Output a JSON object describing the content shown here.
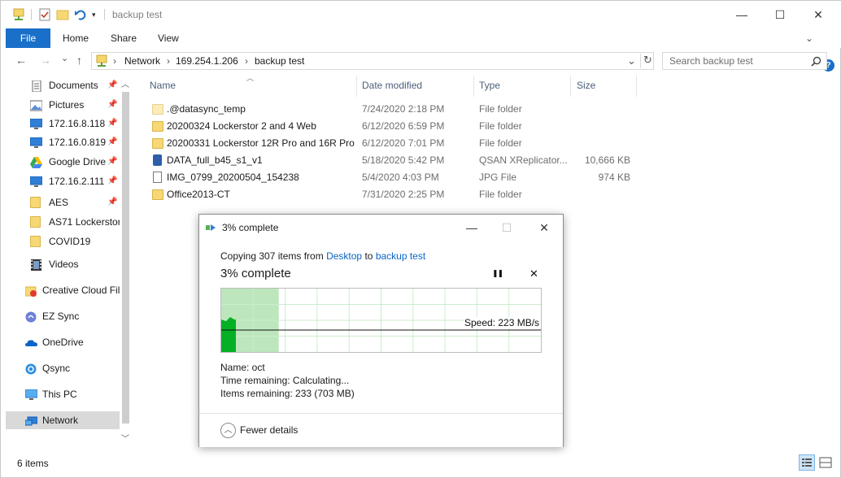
{
  "window": {
    "title": "backup test",
    "min": "—",
    "max": "☐",
    "close": "✕"
  },
  "ribbon": {
    "file": "File",
    "home": "Home",
    "share": "Share",
    "view": "View",
    "expand": "⌄",
    "help": "?"
  },
  "nav": {
    "back": "←",
    "forward": "→",
    "recent": "⌄",
    "up": "↑",
    "breadcrumb": [
      "Network",
      "169.254.1.206",
      "backup test"
    ],
    "sep": "›",
    "dropdown": "⌄",
    "refresh": "↻",
    "search_placeholder": "Search backup test"
  },
  "sidebar": {
    "items": [
      {
        "label": "Documents",
        "icon": "documents-icon",
        "pinned": true
      },
      {
        "label": "Pictures",
        "icon": "pictures-icon",
        "pinned": true
      },
      {
        "label": "172.16.8.118",
        "icon": "monitor-icon",
        "pinned": true
      },
      {
        "label": "172.16.0.819",
        "icon": "monitor-icon",
        "pinned": true
      },
      {
        "label": "Google Drive",
        "icon": "google-drive-icon",
        "pinned": true
      },
      {
        "label": "172.16.2.111",
        "icon": "monitor-icon",
        "pinned": true
      },
      {
        "label": "AES",
        "icon": "folder-icon",
        "pinned": true
      },
      {
        "label": "AS71 Lockerstor",
        "icon": "folder-icon",
        "pinned": false
      },
      {
        "label": "COVID19",
        "icon": "folder-icon",
        "pinned": false
      },
      {
        "label": "Videos",
        "icon": "videos-icon",
        "pinned": false
      },
      {
        "label": "Creative Cloud Fil",
        "icon": "creative-cloud-icon",
        "pinned": false
      },
      {
        "label": "EZ Sync",
        "icon": "ez-sync-icon",
        "pinned": false
      },
      {
        "label": "OneDrive",
        "icon": "onedrive-icon",
        "pinned": false
      },
      {
        "label": "Qsync",
        "icon": "qsync-icon",
        "pinned": false
      },
      {
        "label": "This PC",
        "icon": "this-pc-icon",
        "pinned": false
      },
      {
        "label": "Network",
        "icon": "network-icon",
        "pinned": false,
        "selected": true
      }
    ],
    "pin_glyph": "📌"
  },
  "columns": {
    "name": "Name",
    "date": "Date modified",
    "type": "Type",
    "size": "Size"
  },
  "files": [
    {
      "name": ".@datasync_temp",
      "date": "7/24/2020 2:18 PM",
      "type": "File folder",
      "size": "",
      "icon": "folder-hidden-icon"
    },
    {
      "name": "20200324 Lockerstor 2 and 4 Web",
      "date": "6/12/2020 6:59 PM",
      "type": "File folder",
      "size": "",
      "icon": "folder-icon"
    },
    {
      "name": "20200331 Lockerstor 12R Pro and 16R Pro",
      "date": "6/12/2020 7:01 PM",
      "type": "File folder",
      "size": "",
      "icon": "folder-icon"
    },
    {
      "name": "DATA_full_b45_s1_v1",
      "date": "5/18/2020 5:42 PM",
      "type": "QSAN XReplicator...",
      "size": "10,666 KB",
      "icon": "qsan-file-icon"
    },
    {
      "name": "IMG_0799_20200504_154238",
      "date": "5/4/2020 4:03 PM",
      "type": "JPG File",
      "size": "974 KB",
      "icon": "image-file-icon"
    },
    {
      "name": "Office2013-CT",
      "date": "7/31/2020 2:25 PM",
      "type": "File folder",
      "size": "",
      "icon": "folder-icon"
    }
  ],
  "status": {
    "count": "6 items"
  },
  "copy_dialog": {
    "title": "3% complete",
    "copying_prefix": "Copying 307 items from",
    "source": "Desktop",
    "to_word": "to",
    "destination": "backup test",
    "progress_label": "3% complete",
    "progress_fraction": 0.03,
    "pause": "❚❚",
    "cancel": "✕",
    "speed": "Speed:  223 MB/s",
    "name": "Name:  oct",
    "time_remaining": "Time remaining:  Calculating...",
    "items_remaining": "Items remaining:  233 (703 MB)",
    "fewer_details": "Fewer details",
    "chevron_up": "︿",
    "colors": {
      "graph_fill": "#06b025",
      "graph_done_bg": "#bde6bd",
      "grid": "#cdeccd",
      "link": "#0a64c8"
    }
  }
}
